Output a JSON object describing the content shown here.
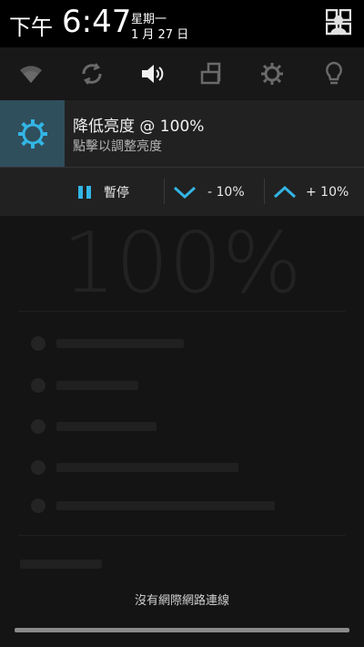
{
  "status": {
    "time_prefix": "下午",
    "time": "6:47",
    "weekday": "星期一",
    "date": "1 月 27 日"
  },
  "quick_settings": [
    {
      "icon": "wifi-icon"
    },
    {
      "icon": "sync-icon"
    },
    {
      "icon": "volume-icon"
    },
    {
      "icon": "screen-rotation-icon"
    },
    {
      "icon": "brightness-icon"
    },
    {
      "icon": "flashlight-icon"
    }
  ],
  "notification": {
    "icon": "brightness-gear-icon",
    "title": "降低亮度 @ 100%",
    "subtitle": "點擊以調整亮度",
    "actions": [
      {
        "label": "暫停",
        "icon": "pause-icon"
      },
      {
        "label": "- 10%",
        "icon": "chevron-down-icon"
      },
      {
        "label": "+ 10%",
        "icon": "chevron-up-icon"
      }
    ]
  },
  "background": {
    "big_value": "100%"
  },
  "footer": {
    "network_status": "沒有網際網路連線"
  },
  "colors": {
    "accent": "#33b5e5",
    "icon_box": "#2f4f5c",
    "card": "#212121"
  }
}
